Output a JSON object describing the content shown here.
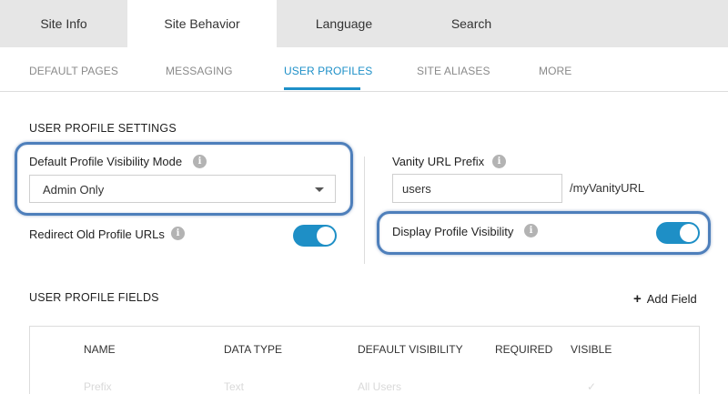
{
  "top_tabs": [
    "Site Info",
    "Site Behavior",
    "Language",
    "Search"
  ],
  "sub_tabs": [
    "DEFAULT PAGES",
    "MESSAGING",
    "USER PROFILES",
    "SITE ALIASES",
    "MORE"
  ],
  "settings": {
    "section_title": "USER PROFILE SETTINGS",
    "visibility_mode_label": "Default Profile Visibility Mode",
    "visibility_mode_value": "Admin Only",
    "redirect_label": "Redirect Old Profile URLs",
    "redirect_on": true,
    "vanity_label": "Vanity URL Prefix",
    "vanity_value": "users",
    "vanity_suffix": "/myVanityURL",
    "display_visibility_label": "Display Profile Visibility",
    "display_visibility_on": true,
    "info_glyph": "i"
  },
  "fields": {
    "section_title": "USER PROFILE FIELDS",
    "add_plus": "+",
    "add_label": "Add Field",
    "columns": [
      "NAME",
      "DATA TYPE",
      "DEFAULT VISIBILITY",
      "REQUIRED",
      "VISIBLE"
    ],
    "rows": [
      {
        "name": "Prefix",
        "data_type": "Text",
        "default_visibility": "All Users",
        "visible_mark": "✓"
      }
    ]
  },
  "colors": {
    "accent": "#1e8fc6",
    "highlight": "#4e7fbb"
  },
  "icons": {
    "info": "info-icon",
    "caret": "chevron-down-icon",
    "plus": "plus-icon",
    "check": "check-icon"
  }
}
